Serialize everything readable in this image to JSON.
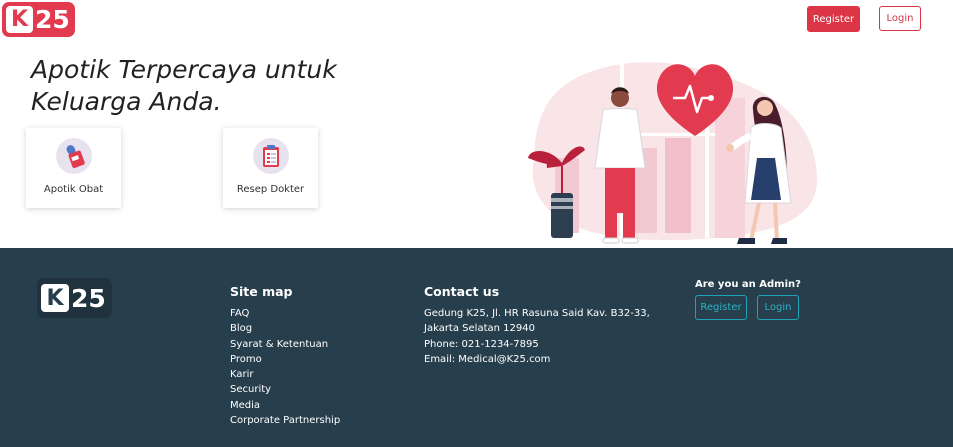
{
  "header": {
    "logo_letter": "K",
    "logo_number": "25",
    "register_label": "Register",
    "login_label": "Login"
  },
  "hero": {
    "title": "Apotik Terpercaya untuk Keluarga Anda.",
    "cards": [
      {
        "label": "Apotik Obat",
        "icon": "medicine-icon"
      },
      {
        "label": "Resep Dokter",
        "icon": "prescription-clipboard-icon"
      }
    ]
  },
  "footer": {
    "logo_letter": "K",
    "logo_number": "25",
    "sitemap": {
      "title": "Site map",
      "links": [
        "FAQ",
        "Blog",
        "Syarat & Ketentuan",
        "Promo",
        "Karir",
        "Security",
        "Media",
        "Corporate Partnership"
      ]
    },
    "contact": {
      "title": "Contact us",
      "lines": [
        "Gedung K25, Jl. HR Rasuna Said Kav. B32-33,",
        "Jakarta Selatan 12940",
        "Phone: 021-1234-7895",
        "Email: Medical@K25.com"
      ]
    },
    "admin": {
      "question": "Are you an Admin?",
      "register_label": "Register",
      "login_label": "Login"
    }
  },
  "colors": {
    "brand_red": "#dc3545",
    "footer_bg": "#273f4d",
    "admin_accent": "#1fa3b4"
  }
}
